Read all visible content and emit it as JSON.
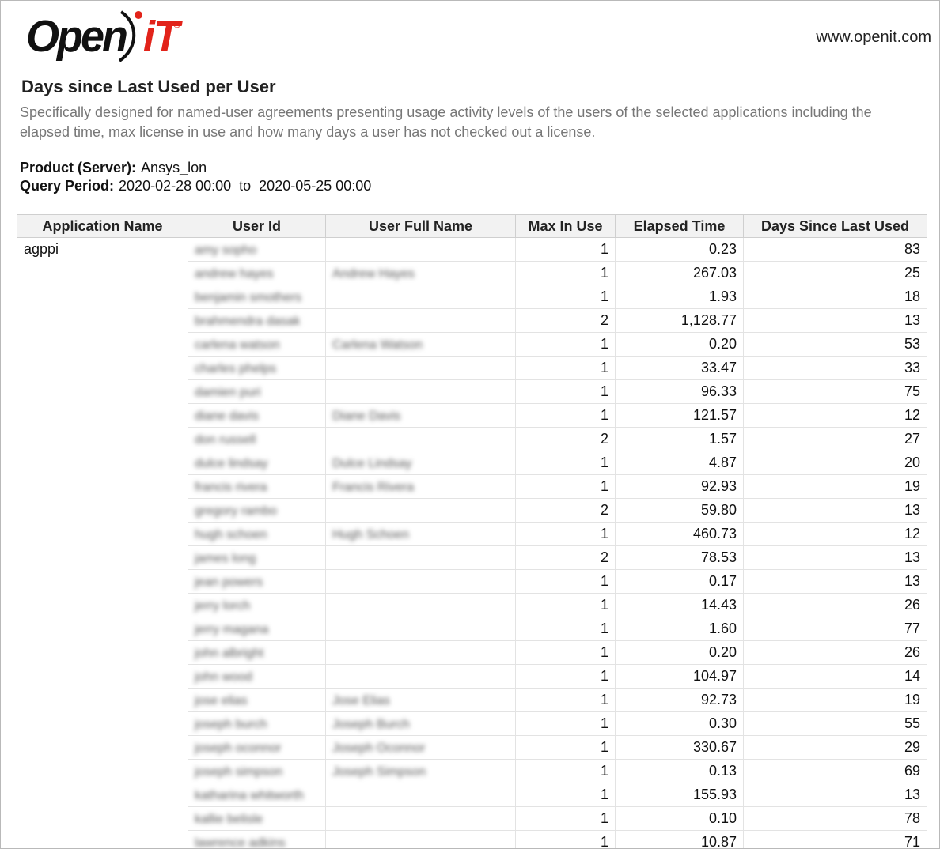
{
  "header": {
    "logo_open": "Open",
    "logo_it": "iT",
    "logo_reg": "®",
    "website": "www.openit.com"
  },
  "report": {
    "title": "Days since Last Used per User",
    "description": "Specifically designed for named-user agreements presenting usage activity levels of the users of the selected applications including the elapsed time, max license in use and how many days a user has not checked out a license.",
    "product_label": "Product (Server):",
    "product_value": "Ansys_lon",
    "period_label": "Query Period:",
    "period_value": "2020-02-28 00:00  to  2020-05-25 00:00"
  },
  "table": {
    "columns": [
      "Application Name",
      "User Id",
      "User Full Name",
      "Max In Use",
      "Elapsed Time",
      "Days Since Last Used"
    ],
    "application": "agppi",
    "rows": [
      {
        "user_id": "amy sopho",
        "full_name": "",
        "max_in_use": "1",
        "elapsed": "0.23",
        "days": "83"
      },
      {
        "user_id": "andrew hayes",
        "full_name": "Andrew Hayes",
        "max_in_use": "1",
        "elapsed": "267.03",
        "days": "25"
      },
      {
        "user_id": "benjamin smothers",
        "full_name": "",
        "max_in_use": "1",
        "elapsed": "1.93",
        "days": "18"
      },
      {
        "user_id": "brahmendra dasak",
        "full_name": "",
        "max_in_use": "2",
        "elapsed": "1,128.77",
        "days": "13"
      },
      {
        "user_id": "carlena watson",
        "full_name": "Carlena Watson",
        "max_in_use": "1",
        "elapsed": "0.20",
        "days": "53"
      },
      {
        "user_id": "charles phelps",
        "full_name": "",
        "max_in_use": "1",
        "elapsed": "33.47",
        "days": "33"
      },
      {
        "user_id": "damien puri",
        "full_name": "",
        "max_in_use": "1",
        "elapsed": "96.33",
        "days": "75"
      },
      {
        "user_id": "diane davis",
        "full_name": "Diane Davis",
        "max_in_use": "1",
        "elapsed": "121.57",
        "days": "12"
      },
      {
        "user_id": "don russell",
        "full_name": "",
        "max_in_use": "2",
        "elapsed": "1.57",
        "days": "27"
      },
      {
        "user_id": "dulce lindsay",
        "full_name": "Dulce Lindsay",
        "max_in_use": "1",
        "elapsed": "4.87",
        "days": "20"
      },
      {
        "user_id": "francis rivera",
        "full_name": "Francis Rivera",
        "max_in_use": "1",
        "elapsed": "92.93",
        "days": "19"
      },
      {
        "user_id": "gregory rambo",
        "full_name": "",
        "max_in_use": "2",
        "elapsed": "59.80",
        "days": "13"
      },
      {
        "user_id": "hugh schoen",
        "full_name": "Hugh Schoen",
        "max_in_use": "1",
        "elapsed": "460.73",
        "days": "12"
      },
      {
        "user_id": "james long",
        "full_name": "",
        "max_in_use": "2",
        "elapsed": "78.53",
        "days": "13"
      },
      {
        "user_id": "jean powers",
        "full_name": "",
        "max_in_use": "1",
        "elapsed": "0.17",
        "days": "13"
      },
      {
        "user_id": "jerry lorch",
        "full_name": "",
        "max_in_use": "1",
        "elapsed": "14.43",
        "days": "26"
      },
      {
        "user_id": "jerry magana",
        "full_name": "",
        "max_in_use": "1",
        "elapsed": "1.60",
        "days": "77"
      },
      {
        "user_id": "john albright",
        "full_name": "",
        "max_in_use": "1",
        "elapsed": "0.20",
        "days": "26"
      },
      {
        "user_id": "john wood",
        "full_name": "",
        "max_in_use": "1",
        "elapsed": "104.97",
        "days": "14"
      },
      {
        "user_id": "jose elias",
        "full_name": "Jose Elias",
        "max_in_use": "1",
        "elapsed": "92.73",
        "days": "19"
      },
      {
        "user_id": "joseph burch",
        "full_name": "Joseph Burch",
        "max_in_use": "1",
        "elapsed": "0.30",
        "days": "55"
      },
      {
        "user_id": "joseph oconnor",
        "full_name": "Joseph Oconnor",
        "max_in_use": "1",
        "elapsed": "330.67",
        "days": "29"
      },
      {
        "user_id": "joseph simpson",
        "full_name": "Joseph Simpson",
        "max_in_use": "1",
        "elapsed": "0.13",
        "days": "69"
      },
      {
        "user_id": "katharina whitworth",
        "full_name": "",
        "max_in_use": "1",
        "elapsed": "155.93",
        "days": "13"
      },
      {
        "user_id": "kallie belisle",
        "full_name": "",
        "max_in_use": "1",
        "elapsed": "0.10",
        "days": "78"
      },
      {
        "user_id": "lawrence adkins",
        "full_name": "",
        "max_in_use": "1",
        "elapsed": "10.87",
        "days": "71"
      }
    ]
  }
}
